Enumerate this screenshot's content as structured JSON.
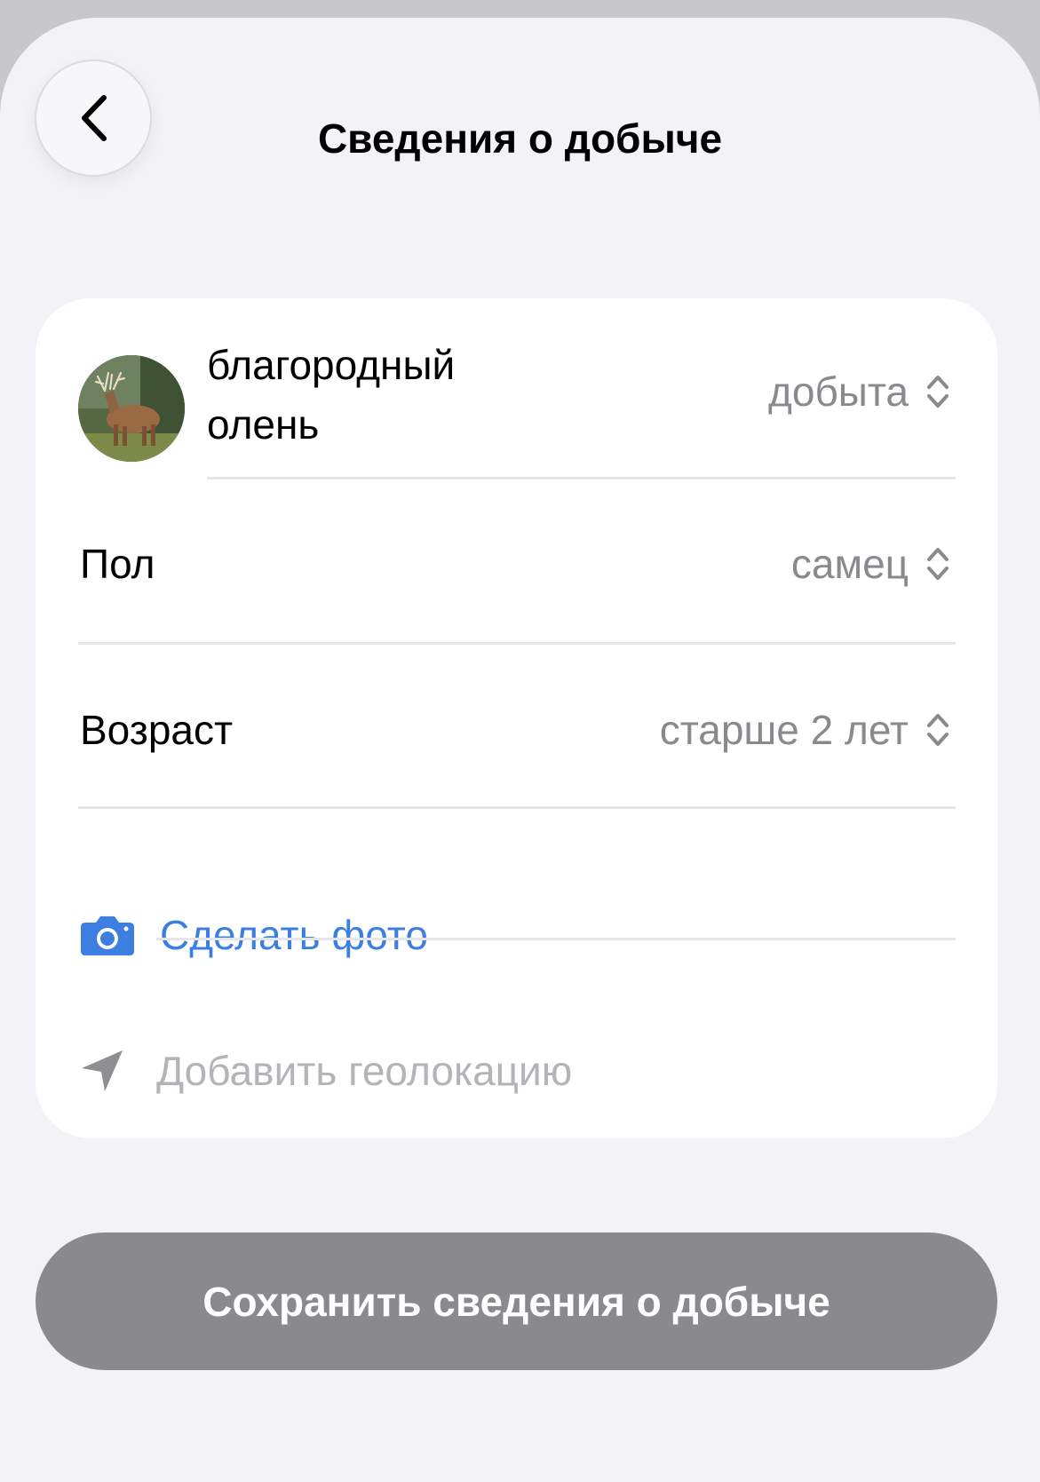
{
  "header": {
    "title": "Сведения о добыче",
    "back_icon": "chevron-left-icon"
  },
  "card": {
    "species": {
      "name": "благородный олень",
      "status_value": "добыта",
      "avatar_icon": "deer-photo"
    },
    "sex": {
      "label": "Пол",
      "value": "самец"
    },
    "age": {
      "label": "Возраст",
      "value": "старше 2 лет"
    },
    "photo": {
      "label": "Сделать фото",
      "icon": "camera-icon",
      "color": "#3d7fe0"
    },
    "location": {
      "label": "Добавить геолокацию",
      "icon": "location-arrow-icon"
    }
  },
  "footer": {
    "save_label": "Сохранить сведения о добыче",
    "save_color": "#8a8a8e"
  }
}
